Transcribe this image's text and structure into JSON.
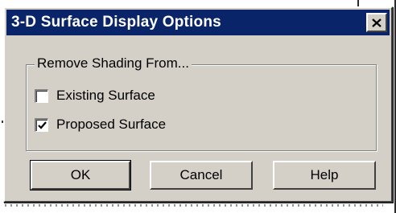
{
  "dialog": {
    "title": "3-D Surface Display Options",
    "close_icon": "close-x"
  },
  "group": {
    "label": "Remove Shading From...",
    "options": [
      {
        "label": "Existing Surface",
        "checked": false
      },
      {
        "label": "Proposed Surface",
        "checked": true
      }
    ]
  },
  "buttons": {
    "ok": "OK",
    "cancel": "Cancel",
    "help": "Help"
  },
  "colors": {
    "titlebar": "#0a246a",
    "face": "#d4d0c8"
  }
}
